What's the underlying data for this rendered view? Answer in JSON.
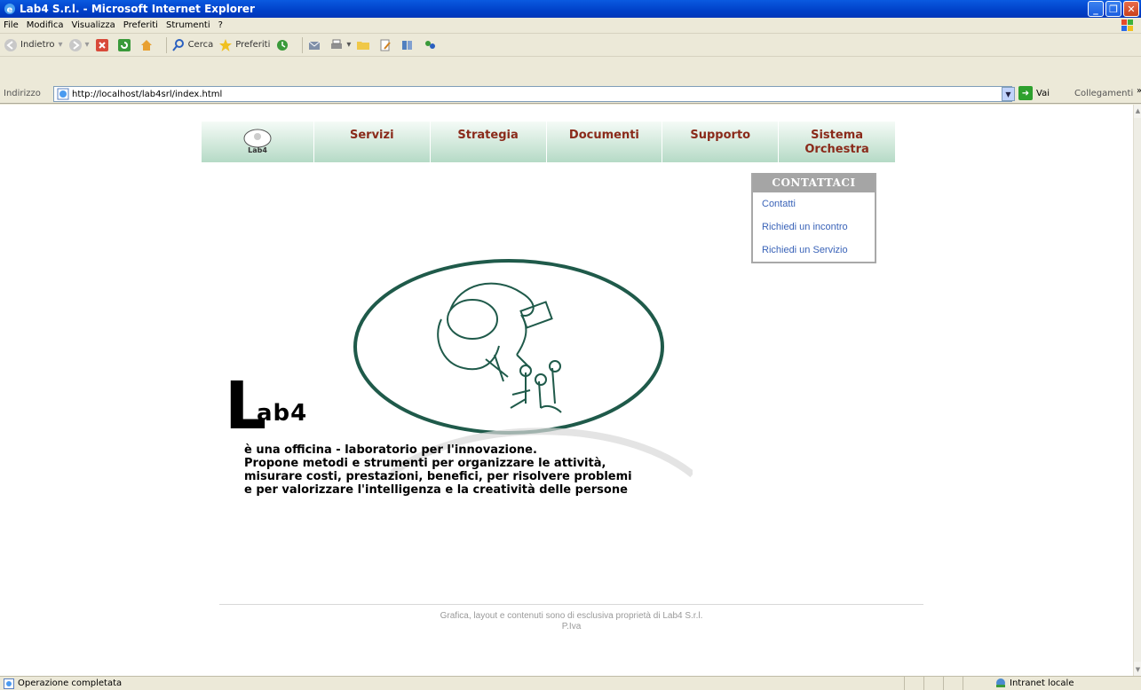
{
  "window": {
    "title": "Lab4 S.r.l. - Microsoft Internet Explorer"
  },
  "menubar": {
    "items": [
      "File",
      "Modifica",
      "Visualizza",
      "Preferiti",
      "Strumenti",
      "?"
    ]
  },
  "toolbar": {
    "back_label": "Indietro",
    "search_label": "Cerca",
    "favorites_label": "Preferiti"
  },
  "addressbar": {
    "label": "Indirizzo",
    "url": "http://localhost/lab4srl/index.html",
    "go_label": "Vai",
    "links_label": "Collegamenti"
  },
  "nav": {
    "logo_text": "Lab4",
    "items": [
      "Servizi",
      "Strategia",
      "Documenti",
      "Supporto"
    ],
    "last_line1": "Sistema",
    "last_line2": "Orchestra",
    "text_color": "#8a2a1a"
  },
  "contact": {
    "header": "CONTATTACI",
    "links": [
      "Contatti",
      "Richiedi un incontro",
      "Richiedi un Servizio"
    ]
  },
  "hero": {
    "big_letter": "L",
    "rest": "ab4",
    "lines": [
      "è una officina - laboratorio per l'innovazione.",
      "Propone metodi e strumenti per organizzare le attività,",
      "misurare costi, prestazioni, benefici, per risolvere problemi",
      "e per valorizzare l'intelligenza e la creatività delle persone"
    ]
  },
  "footer": {
    "line1": "Grafica, layout e contenuti sono di esclusiva proprietà di Lab4 S.r.l.",
    "line2": "P.Iva"
  },
  "statusbar": {
    "status": "Operazione completata",
    "zone": "Intranet locale"
  }
}
